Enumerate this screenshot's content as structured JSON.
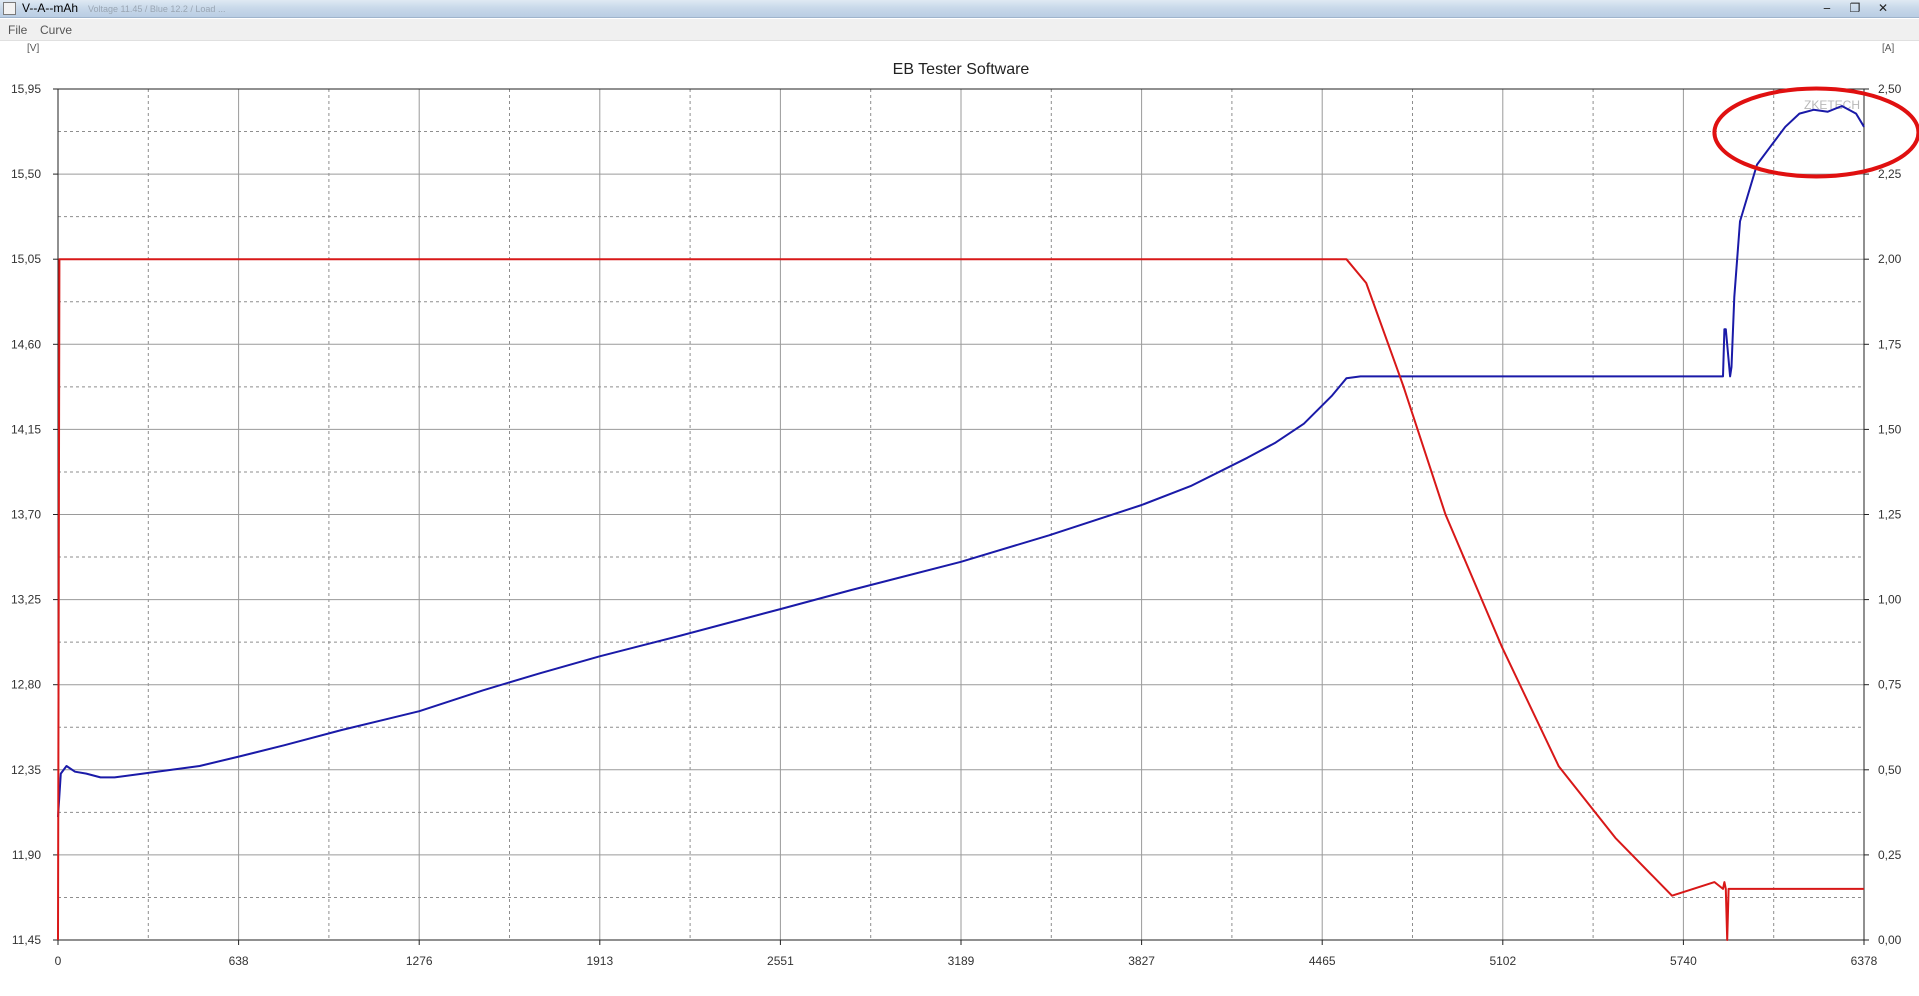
{
  "window": {
    "title": "V--A--mAh",
    "title_tail": "Voltage 11.45 / Blue   12.2 / Load ..."
  },
  "menu": {
    "items": [
      "File",
      "Curve"
    ]
  },
  "colors": {
    "voltage_series": "#1a1aa8",
    "current_series": "#d81818",
    "annotation": "#e01010",
    "grid": "#a0a0a0"
  },
  "chart_data": {
    "type": "line",
    "title": "EB Tester Software",
    "left_unit": "[V]",
    "right_unit": "[A]",
    "watermark": "ZKETECH",
    "x_range": [
      0,
      6378
    ],
    "x_ticks": [
      "0",
      "638",
      "1276",
      "1913",
      "2551",
      "3189",
      "3827",
      "4465",
      "5102",
      "5740",
      "6378"
    ],
    "y_left_range": [
      11.45,
      15.95
    ],
    "y_left_ticks": [
      "11,45",
      "11,90",
      "12,35",
      "12,80",
      "13,25",
      "13,70",
      "14,15",
      "14,60",
      "15,05",
      "15,50",
      "15,95"
    ],
    "y_right_range": [
      0,
      2.5
    ],
    "y_right_ticks": [
      "0,00",
      "0,25",
      "0,50",
      "0,75",
      "1,00",
      "1,25",
      "1,50",
      "1,75",
      "2,00",
      "2,25",
      "2,50"
    ],
    "grid": true,
    "series": [
      {
        "axis": "left",
        "x": [
          0,
          10,
          30,
          60,
          100,
          150,
          200,
          300,
          500,
          638,
          800,
          1000,
          1276,
          1500,
          1700,
          1913,
          2200,
          2551,
          2800,
          3189,
          3500,
          3827,
          4000,
          4200,
          4300,
          4400,
          4500,
          4550,
          4600,
          5000,
          5500,
          5880,
          5885,
          5890,
          5905,
          5910,
          5920,
          5940,
          5980,
          6000,
          6050,
          6100,
          6150,
          6200,
          6250,
          6300,
          6350,
          6378
        ],
        "y": [
          12.1,
          12.33,
          12.37,
          12.34,
          12.33,
          12.31,
          12.31,
          12.33,
          12.37,
          12.42,
          12.48,
          12.56,
          12.66,
          12.77,
          12.86,
          12.95,
          13.06,
          13.2,
          13.3,
          13.45,
          13.59,
          13.75,
          13.85,
          14.0,
          14.08,
          14.18,
          14.33,
          14.42,
          14.43,
          14.43,
          14.43,
          14.43,
          14.68,
          14.68,
          14.43,
          14.48,
          14.85,
          15.25,
          15.45,
          15.55,
          15.65,
          15.75,
          15.82,
          15.84,
          15.83,
          15.86,
          15.82,
          15.75
        ]
      },
      {
        "axis": "right",
        "x": [
          0,
          5,
          10,
          4550,
          4620,
          4750,
          4900,
          5100,
          5300,
          5500,
          5700,
          5850,
          5880,
          5885,
          5890,
          5895,
          5900,
          6378
        ],
        "y": [
          0.0,
          2.0,
          2.0,
          2.0,
          1.93,
          1.63,
          1.25,
          0.86,
          0.51,
          0.3,
          0.13,
          0.17,
          0.15,
          0.17,
          0.15,
          0.0,
          0.15,
          0.15
        ]
      }
    ]
  }
}
